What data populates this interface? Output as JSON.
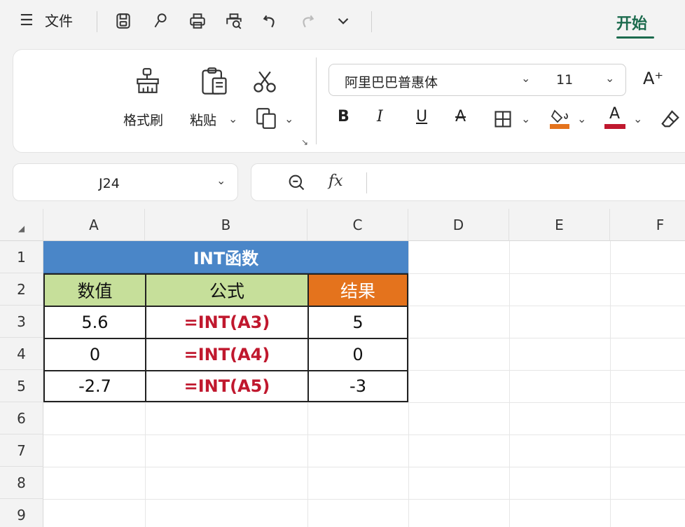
{
  "topbar": {
    "menu_icon": "menu-icon",
    "file_label": "文件",
    "start_tab": "开始",
    "quick_icons": [
      "save-icon",
      "brush-icon",
      "print-icon",
      "print-preview-icon",
      "undo-icon",
      "redo-icon",
      "chevron-down-icon"
    ]
  },
  "ribbon": {
    "format_painter_label": "格式刷",
    "paste_label": "粘贴",
    "font_name": "阿里巴巴普惠体",
    "font_size": "11",
    "grow_font": "A⁺",
    "bold": "B",
    "italic": "I",
    "underline": "U",
    "strike": "A",
    "font_color_glyph": "A",
    "accent_fill": "#e4731d",
    "accent_font": "#c0182e"
  },
  "formula_bar": {
    "cell_ref": "J24",
    "fx": "fx",
    "content": ""
  },
  "grid": {
    "columns": [
      "A",
      "B",
      "C",
      "D",
      "E",
      "F"
    ],
    "rows": [
      "1",
      "2",
      "3",
      "4",
      "5",
      "6",
      "7",
      "8",
      "9"
    ],
    "title": "INT函数",
    "headers": [
      "数值",
      "公式",
      "结果"
    ],
    "data": [
      {
        "value": "5.6",
        "formula": "=INT(A3)",
        "result": "5"
      },
      {
        "value": "0",
        "formula": "=INT(A4)",
        "result": "0"
      },
      {
        "value": "-2.7",
        "formula": "=INT(A5)",
        "result": "-3"
      }
    ],
    "colors": {
      "title_bg": "#4a86c8",
      "header_green": "#c6df9a",
      "header_orange": "#e4731d",
      "formula_text": "#c0182e"
    }
  }
}
